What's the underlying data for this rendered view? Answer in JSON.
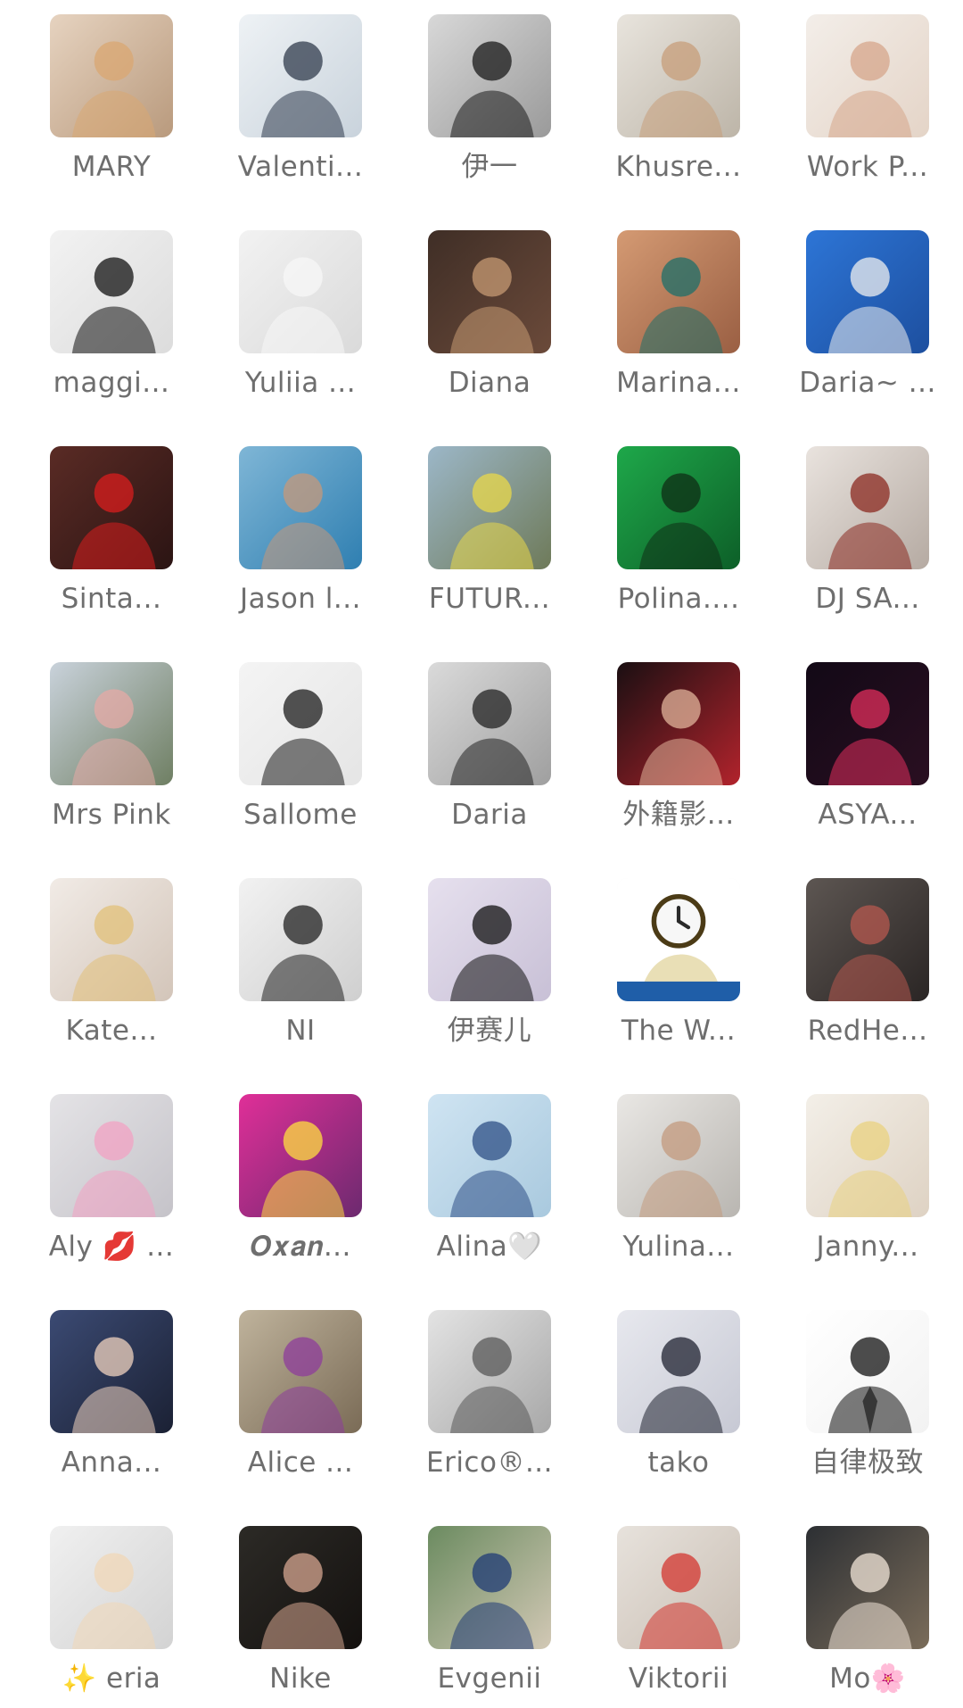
{
  "contacts": [
    {
      "name": "MARY",
      "bg": [
        "#e6d3c0",
        "#b99a7d"
      ],
      "fg": "#d9a772"
    },
    {
      "name": "Valenti...",
      "bg": [
        "#eef2f5",
        "#c9d3dc"
      ],
      "fg": "#303b4c"
    },
    {
      "name": "伊一",
      "bg": [
        "#d8d8d8",
        "#9a9a9a"
      ],
      "fg": "#1a1a1a"
    },
    {
      "name": "Khusre...",
      "bg": [
        "#e8e4dd",
        "#bdb5a8"
      ],
      "fg": "#c79e7a"
    },
    {
      "name": "Work P...",
      "bg": [
        "#f3eee9",
        "#e4d4c7"
      ],
      "fg": "#d6a58b"
    },
    {
      "name": "maggi...",
      "bg": [
        "#f2f2f2",
        "#dcdcdc"
      ],
      "fg": "#111111"
    },
    {
      "name": "Yuliia ...",
      "bg": [
        "#f2f2f2",
        "#dadada"
      ],
      "fg": "#f7f7f7"
    },
    {
      "name": "Diana",
      "bg": [
        "#3f2e26",
        "#6b4a3a"
      ],
      "fg": "#c69a73"
    },
    {
      "name": "Marina...",
      "bg": [
        "#d49a73",
        "#9a5f43"
      ],
      "fg": "#1d6f6a"
    },
    {
      "name": "Daria~ ...",
      "bg": [
        "#2d75d6",
        "#1d4f9f"
      ],
      "fg": "#efefef"
    },
    {
      "name": "Sinta...",
      "bg": [
        "#5a2b25",
        "#2b1413"
      ],
      "fg": "#d91e1e"
    },
    {
      "name": "Jason l...",
      "bg": [
        "#7fb6d6",
        "#2f7fb1"
      ],
      "fg": "#c69879"
    },
    {
      "name": "FUTUR...",
      "bg": [
        "#9cb7c8",
        "#6e7a59"
      ],
      "fg": "#e9d84a"
    },
    {
      "name": "Polina....",
      "bg": [
        "#1ea84a",
        "#0d5f28"
      ],
      "fg": "#0f2d16"
    },
    {
      "name": "DJ SA...",
      "bg": [
        "#e9e3de",
        "#b5aaa2"
      ],
      "fg": "#8b2a20"
    },
    {
      "name": "Mrs Pink",
      "bg": [
        "#c9d2db",
        "#6f7f63"
      ],
      "fg": "#e6a9a6"
    },
    {
      "name": "Sallome",
      "bg": [
        "#f4f4f4",
        "#e5e5e5"
      ],
      "fg": "#1b1b1b"
    },
    {
      "name": "Daria",
      "bg": [
        "#dadada",
        "#9f9f9f"
      ],
      "fg": "#222222"
    },
    {
      "name": "外籍影...",
      "bg": [
        "#1a0f12",
        "#b2232c"
      ],
      "fg": "#e2b49b"
    },
    {
      "name": "ASYA...",
      "bg": [
        "#120916",
        "#2a0f21"
      ],
      "fg": "#e02d5c"
    },
    {
      "name": "Kate...",
      "bg": [
        "#f1ebe6",
        "#d3c5b9"
      ],
      "fg": "#e2c078"
    },
    {
      "name": "NI",
      "bg": [
        "#f2f2f2",
        "#cfcfcf"
      ],
      "fg": "#202020"
    },
    {
      "name": "伊赛儿",
      "bg": [
        "#e6e0ee",
        "#c8c0d6"
      ],
      "fg": "#111111"
    },
    {
      "name": "The W...",
      "bg": [
        "#ffffff",
        "#ffffff"
      ],
      "fg": "#d7c47a"
    },
    {
      "name": "RedHe...",
      "bg": [
        "#5d5652",
        "#2a2524"
      ],
      "fg": "#b5584f"
    },
    {
      "name": "Aly 💋 ...",
      "bg": [
        "#e4e3e6",
        "#c5c3c9"
      ],
      "fg": "#f2a1c3"
    },
    {
      "name": "𝑶𝒙𝒂𝒏...",
      "bg": [
        "#e02f98",
        "#6c2a6f"
      ],
      "fg": "#ffdf3f"
    },
    {
      "name": "Alina🤍",
      "bg": [
        "#cfe4f2",
        "#a9c9de"
      ],
      "fg": "#2e4f86"
    },
    {
      "name": "Yulina...",
      "bg": [
        "#e9e7e4",
        "#b9b6b1"
      ],
      "fg": "#c39a7d"
    },
    {
      "name": "Janny...",
      "bg": [
        "#f3efe8",
        "#ded2c3"
      ],
      "fg": "#e9d27f"
    },
    {
      "name": "Anna...",
      "bg": [
        "#3b4a73",
        "#1b2134"
      ],
      "fg": "#f0d3bf"
    },
    {
      "name": "Alice ...",
      "bg": [
        "#bfb39c",
        "#7a6b56"
      ],
      "fg": "#8d3c9b"
    },
    {
      "name": "Erico®...",
      "bg": [
        "#e3e3e3",
        "#a8a8a8"
      ],
      "fg": "#585858"
    },
    {
      "name": "tako",
      "bg": [
        "#e7e8ee",
        "#c7c9d4"
      ],
      "fg": "#1f2230"
    },
    {
      "name": "自律极致",
      "bg": [
        "#ffffff",
        "#f2f2f2"
      ],
      "fg": "#111111"
    },
    {
      "name": "✨ eria",
      "bg": [
        "#f0f0f0",
        "#d3d3d3"
      ],
      "fg": "#f0d7b7"
    },
    {
      "name": "Nike",
      "bg": [
        "#2c2a26",
        "#14110f"
      ],
      "fg": "#d6a690"
    },
    {
      "name": "Evgenii",
      "bg": [
        "#6b8b60",
        "#d2c8b5"
      ],
      "fg": "#1f3b76"
    },
    {
      "name": "Viktorii",
      "bg": [
        "#e7e2dc",
        "#c9beb3"
      ],
      "fg": "#d3362f"
    },
    {
      "name": "Mo🌸",
      "bg": [
        "#2c2f33",
        "#7a6c5a"
      ],
      "fg": "#f2e5d8"
    }
  ]
}
